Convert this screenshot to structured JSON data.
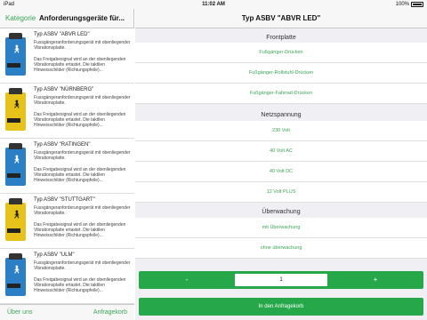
{
  "status_bar": {
    "carrier": "iPad",
    "time": "11:02 AM",
    "battery": "100%"
  },
  "master": {
    "back_label": "Kategorie",
    "title": "Anforderungsgeräte für...",
    "items": [
      {
        "title": "Typ ASBV \"ABVR LED\"",
        "description": "Fussgängeranforderungsgerät mit obenliegender Vibrationsplatte.",
        "text": "Das Freigabesignal wird an der obenliegenden Vibrationsplatte ertastet. Die taktilen Hinweisschilder (Richtungspfeile)...",
        "color": "blue"
      },
      {
        "title": "Typ ASBV \"NÜRNBERG\"",
        "description": "Fussgängeranforderungsgerät mit obenliegender Vibrationsplatte.",
        "text": "Das Freigabesignal wird an der obenliegenden Vibrationsplatte ertastet. Die taktilen Hinweisschilder (Richtungspfeile)...",
        "color": "yellow"
      },
      {
        "title": "Typ ASBV \"RATINGEN\"",
        "description": "Fussgängeranforderungsgerät mit obenliegender Vibrationsplatte.",
        "text": "Das Freigabesignal wird an der obenliegenden Vibrationsplatte ertastet. Die taktilen Hinweisschilder (Richtungspfeile)...",
        "color": "blue"
      },
      {
        "title": "Typ ASBV \"STUTTGART\"",
        "description": "Fussgängeranforderungsgerät mit obenliegender Vibrationsplatte.",
        "text": "Das Freigabesignal wird an der obenliegenden Vibrationsplatte ertastet. Die taktilen Hinweisschilder (Richtungspfeile)...",
        "color": "yellow"
      },
      {
        "title": "Typ ASBV \"ULM\"",
        "description": "Fussgängeranforderungsgerät mit obenliegender Vibrationsplatte.",
        "text": "Das Freigabesignal wird an der obenliegenden Vibrationsplatte ertastet. Die taktilen Hinweisschilder (Richtungspfeile)...",
        "color": "blue"
      }
    ],
    "toolbar": {
      "left": "Über uns",
      "right": "Anfragekorb"
    }
  },
  "detail": {
    "title": "Typ ASBV \"ABVR LED\"",
    "sections": [
      {
        "header": "Frontplatte",
        "options": [
          "Fußgänger-Drücken",
          "Fußgänger-Rollstuhl-Drücken",
          "Fußgänger-Fahrrad-Drücken"
        ]
      },
      {
        "header": "Netzspannung",
        "options": [
          "230 Volt",
          "40 Volt AC",
          "40 Volt DC",
          "12 Volt PLUS"
        ]
      },
      {
        "header": "Überwachung",
        "options": [
          "mit Überwachung",
          "ohne überwachung"
        ]
      }
    ],
    "stepper": {
      "minus": "-",
      "value": "1",
      "plus": "+"
    },
    "add_button": "In den Anfragekorb"
  },
  "colors": {
    "accent": "#26a84a",
    "blue_device": "#2b7fc4",
    "yellow_device": "#e6c21a"
  }
}
